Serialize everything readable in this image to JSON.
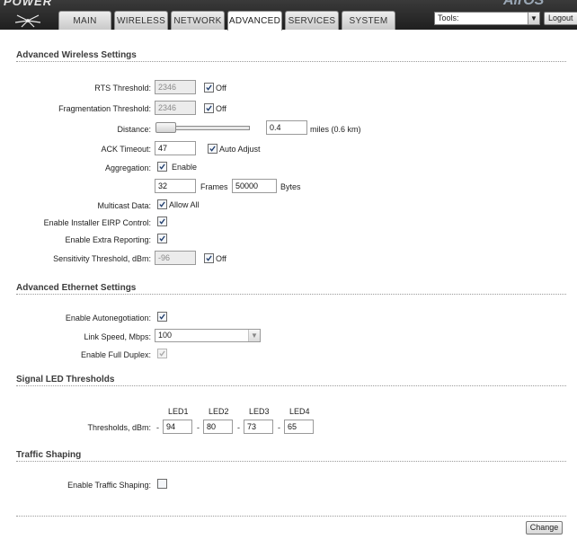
{
  "header": {
    "brand_left": "POWER",
    "brand_right": "AirOS",
    "tabs": [
      "MAIN",
      "WIRELESS",
      "NETWORK",
      "ADVANCED",
      "SERVICES",
      "SYSTEM"
    ],
    "active_tab": "ADVANCED",
    "tools_select": "Tools:",
    "logout_label": "Logout"
  },
  "advanced_wireless": {
    "title": "Advanced Wireless Settings",
    "rts": {
      "label": "RTS Threshold:",
      "value": "2346",
      "checkbox_label": "Off",
      "checked": true
    },
    "fragmentation": {
      "label": "Fragmentation Threshold:",
      "value": "2346",
      "checkbox_label": "Off",
      "checked": true
    },
    "distance": {
      "label": "Distance:",
      "value": "0.4",
      "unit": "miles (0.6 km)",
      "slider_level": 0.05
    },
    "ack_timeout": {
      "label": "ACK Timeout:",
      "value": "47",
      "checkbox_label": "Auto Adjust",
      "checked": true
    },
    "aggregation": {
      "label": "Aggregation:",
      "checkbox_label": "Enable",
      "checked": true,
      "frames_value": "32",
      "frames_label": "Frames",
      "bytes_value": "50000",
      "bytes_label": "Bytes"
    },
    "multicast": {
      "label": "Multicast Data:",
      "checkbox_label": "Allow All",
      "checked": true
    },
    "installer_eirp": {
      "label": "Enable Installer EIRP Control:",
      "checked": true
    },
    "extra_reporting": {
      "label": "Enable Extra Reporting:",
      "checked": true
    },
    "sensitivity": {
      "label": "Sensitivity Threshold, dBm:",
      "value": "-96",
      "checkbox_label": "Off",
      "checked": true
    }
  },
  "advanced_ethernet": {
    "title": "Advanced Ethernet Settings",
    "autonegotiation": {
      "label": "Enable Autonegotiation:",
      "checked": true
    },
    "link_speed": {
      "label": "Link Speed, Mbps:",
      "value": "100"
    },
    "full_duplex": {
      "label": "Enable Full Duplex:",
      "checked": true
    }
  },
  "signal_led": {
    "title": "Signal LED Thresholds",
    "label": "Thresholds, dBm:",
    "leds": [
      {
        "name": "LED1",
        "value": "94"
      },
      {
        "name": "LED2",
        "value": "80"
      },
      {
        "name": "LED3",
        "value": "73"
      },
      {
        "name": "LED4",
        "value": "65"
      }
    ],
    "separator": "-"
  },
  "traffic_shaping": {
    "title": "Traffic Shaping",
    "enable": {
      "label": "Enable Traffic Shaping:",
      "checked": false
    }
  },
  "footer": {
    "change_label": "Change"
  },
  "colors": {
    "topbar": "#2b2b2b",
    "tab_active": "#ffffff",
    "section_title": "#3b3b3b"
  }
}
